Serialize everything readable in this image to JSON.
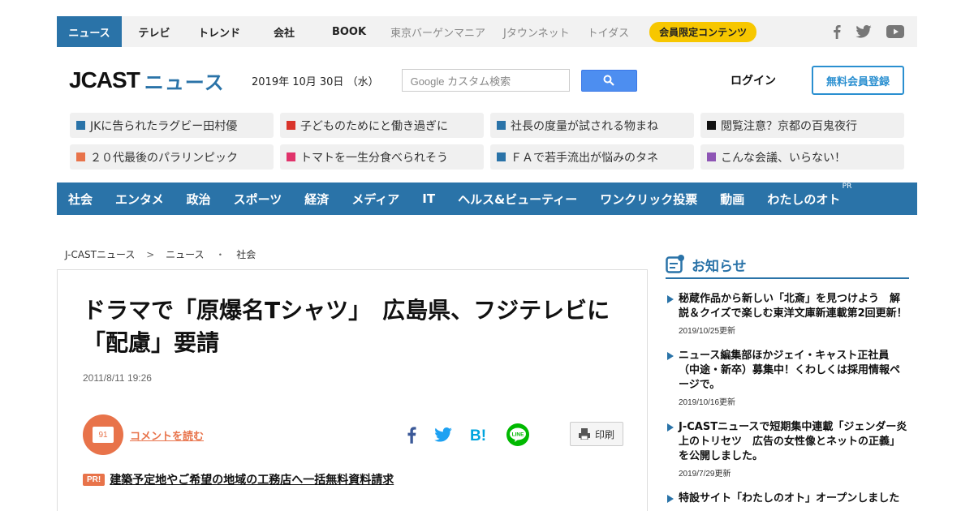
{
  "topbar": {
    "tabs": [
      "ニュース",
      "テレビ",
      "トレンド",
      "会社",
      "BOOK"
    ],
    "external": [
      "東京バーゲンマニア",
      "Jタウンネット",
      "トイダス"
    ],
    "member_label": "会員限定コンテンツ"
  },
  "header": {
    "logo_jcast": "JCAST",
    "logo_news": "ニュース",
    "date": "2019年 10月 30日 （水）",
    "search_placeholder": "Google カスタム検索",
    "login": "ログイン",
    "register": "無料会員登録"
  },
  "trending": [
    {
      "label": "JKに告られたラグビー田村優",
      "color": "#2a73a8"
    },
    {
      "label": "子どものためにと働き過ぎに",
      "color": "#d9342b"
    },
    {
      "label": "社長の度量が試される物まね",
      "color": "#2a73a8"
    },
    {
      "label": "閲覧注意？京都の百鬼夜行",
      "color": "#111111"
    },
    {
      "label": "２０代最後のパラリンピック",
      "color": "#e8734a"
    },
    {
      "label": "トマトを一生分食べられそう",
      "color": "#e0336b"
    },
    {
      "label": "ＦＡで若手流出が悩みのタネ",
      "color": "#2a73a8"
    },
    {
      "label": "こんな会議、いらない！",
      "color": "#8e55b5"
    }
  ],
  "categories": [
    "社会",
    "エンタメ",
    "政治",
    "スポーツ",
    "経済",
    "メディア",
    "IT",
    "ヘルス&ビューティー",
    "ワンクリック投票",
    "動画",
    "わたしのオト"
  ],
  "categories_pr": "PR",
  "breadcrumb": [
    "J-CASTニュース",
    "ニュース",
    "社会"
  ],
  "breadcrumb_seps": [
    ">",
    "・"
  ],
  "article": {
    "title": "ドラマで「原爆名Tシャツ」　広島県、フジテレビに「配慮」要請",
    "date": "2011/8/11 19:26",
    "comment_count": "91",
    "comment_label": "コメントを読む",
    "print_label": "印刷",
    "pr_badge": "PR!",
    "pr_link": "建築予定地やご希望の地域の工務店へ一括無料資料請求"
  },
  "sidebar": {
    "title": "お知らせ",
    "notices": [
      {
        "text": "秘蔵作品から新しい「北斎」を見つけよう　解説＆クイズで楽しむ東洋文庫新連載第2回更新！",
        "date": "2019/10/25更新"
      },
      {
        "text": "ニュース編集部ほかジェイ・キャスト正社員（中途・新卒）募集中！くわしくは採用情報ページで。",
        "date": "2019/10/16更新"
      },
      {
        "text": "J-CASTニュースで短期集中連載「ジェンダー炎上のトリセツ　広告の女性像とネットの正義」を公開しました。",
        "date": "2019/7/29更新"
      },
      {
        "text": "特設サイト「わたしのオト」オープンしました",
        "date": ""
      }
    ]
  },
  "colors": {
    "brand": "#2a73a8",
    "accent": "#e8734a",
    "member": "#f7c700"
  }
}
